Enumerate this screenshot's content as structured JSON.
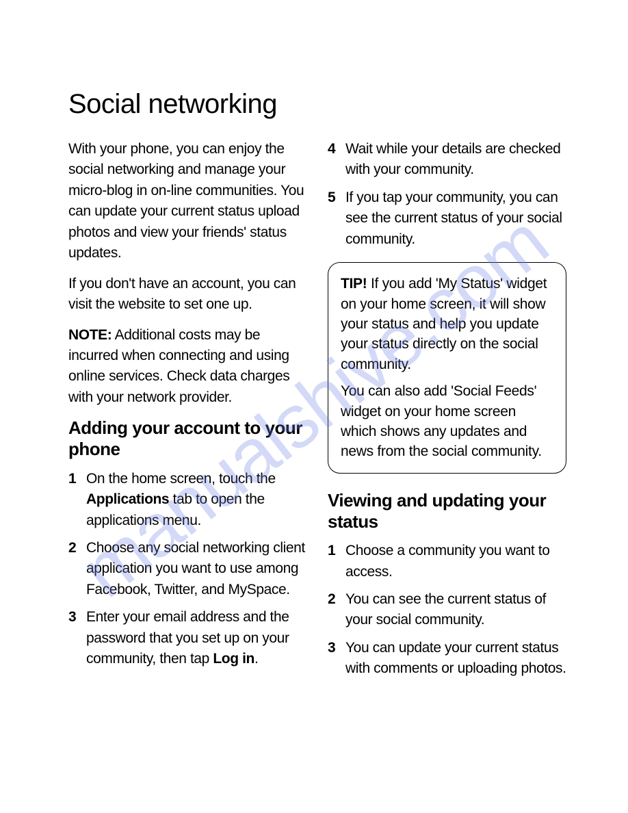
{
  "title": "Social networking",
  "intro1": "With your phone, you can enjoy the social networking and manage your micro-blog in on-line communities. You can update your current status upload photos and view your friends' status updates.",
  "intro2": "If you don't have an account, you can visit the website to set one up.",
  "note_label": "NOTE:",
  "note_text": " Additional costs may be incurred when connecting and using online services. Check data charges with your network provider.",
  "section1_heading": "Adding your account to your phone",
  "steps1": [
    {
      "num": "1",
      "pre": "On the home screen, touch the ",
      "bold": "Applications",
      "post": " tab to open the applications menu."
    },
    {
      "num": "2",
      "text": "Choose any social networking client application you want to use among Facebook, Twitter, and MySpace."
    },
    {
      "num": "3",
      "pre": "Enter your email address and the password that you set up on your community, then tap ",
      "bold": "Log in",
      "post": "."
    },
    {
      "num": "4",
      "text": "Wait while your details are checked with your community."
    },
    {
      "num": "5",
      "text": "If you tap your community, you can see the current status of your social community."
    }
  ],
  "tip_label": "TIP!",
  "tip1": " If you add 'My Status' widget on your home screen, it will show your status and help you update your status directly on the social community.",
  "tip2": "You can also add 'Social Feeds' widget on your home screen which shows any updates and news from the social community.",
  "section2_heading": "Viewing and updating your status",
  "steps2": [
    {
      "num": "1",
      "text": "Choose a community you want to access."
    },
    {
      "num": "2",
      "text": "You can see the current status of your social community."
    },
    {
      "num": "3",
      "text": "You can update your current status with comments or uploading photos."
    }
  ],
  "watermark": "manualshive.com"
}
